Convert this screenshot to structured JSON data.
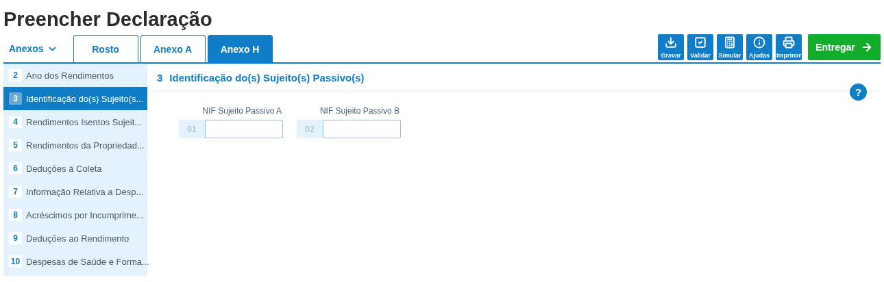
{
  "page_title": "Preencher Declaração",
  "annexes_menu": {
    "label": "Anexos",
    "expanded": false
  },
  "tabs": [
    {
      "label": "Rosto",
      "selected": false
    },
    {
      "label": "Anexo A",
      "selected": false
    },
    {
      "label": "Anexo H",
      "selected": true
    }
  ],
  "toolbar": [
    {
      "kind": "save",
      "label": "Gravar"
    },
    {
      "kind": "validate",
      "label": "Validar"
    },
    {
      "kind": "simulate",
      "label": "Simular"
    },
    {
      "kind": "help",
      "label": "Ajudas"
    },
    {
      "kind": "print",
      "label": "Imprimir"
    }
  ],
  "submit_button": {
    "label": "Entregar"
  },
  "sidebar": {
    "items": [
      {
        "number": "2",
        "label": "Ano dos Rendimentos",
        "selected": false
      },
      {
        "number": "3",
        "label": "Identificação do(s) Sujeito(s...",
        "selected": true
      },
      {
        "number": "4",
        "label": "Rendimentos Isentos Sujeit...",
        "selected": false
      },
      {
        "number": "5",
        "label": "Rendimentos da Propriedad...",
        "selected": false
      },
      {
        "number": "6",
        "label": "Deduções à Coleta",
        "selected": false
      },
      {
        "number": "7",
        "label": "Informação Relativa a Desp...",
        "selected": false
      },
      {
        "number": "8",
        "label": "Acréscimos por Incumprime...",
        "selected": false
      },
      {
        "number": "9",
        "label": "Deduções ao Rendimento",
        "selected": false
      },
      {
        "number": "10",
        "label": "Despesas de Saúde e Forma...",
        "selected": false
      }
    ]
  },
  "section": {
    "number": "3",
    "title": "Identificação do(s) Sujeito(s) Passivo(s)",
    "help_label": "?",
    "fields": [
      {
        "code": "01",
        "label": "NIF Sujeito Passivo A"
      },
      {
        "code": "02",
        "label": "NIF Sujeito Passivo B"
      }
    ]
  }
}
